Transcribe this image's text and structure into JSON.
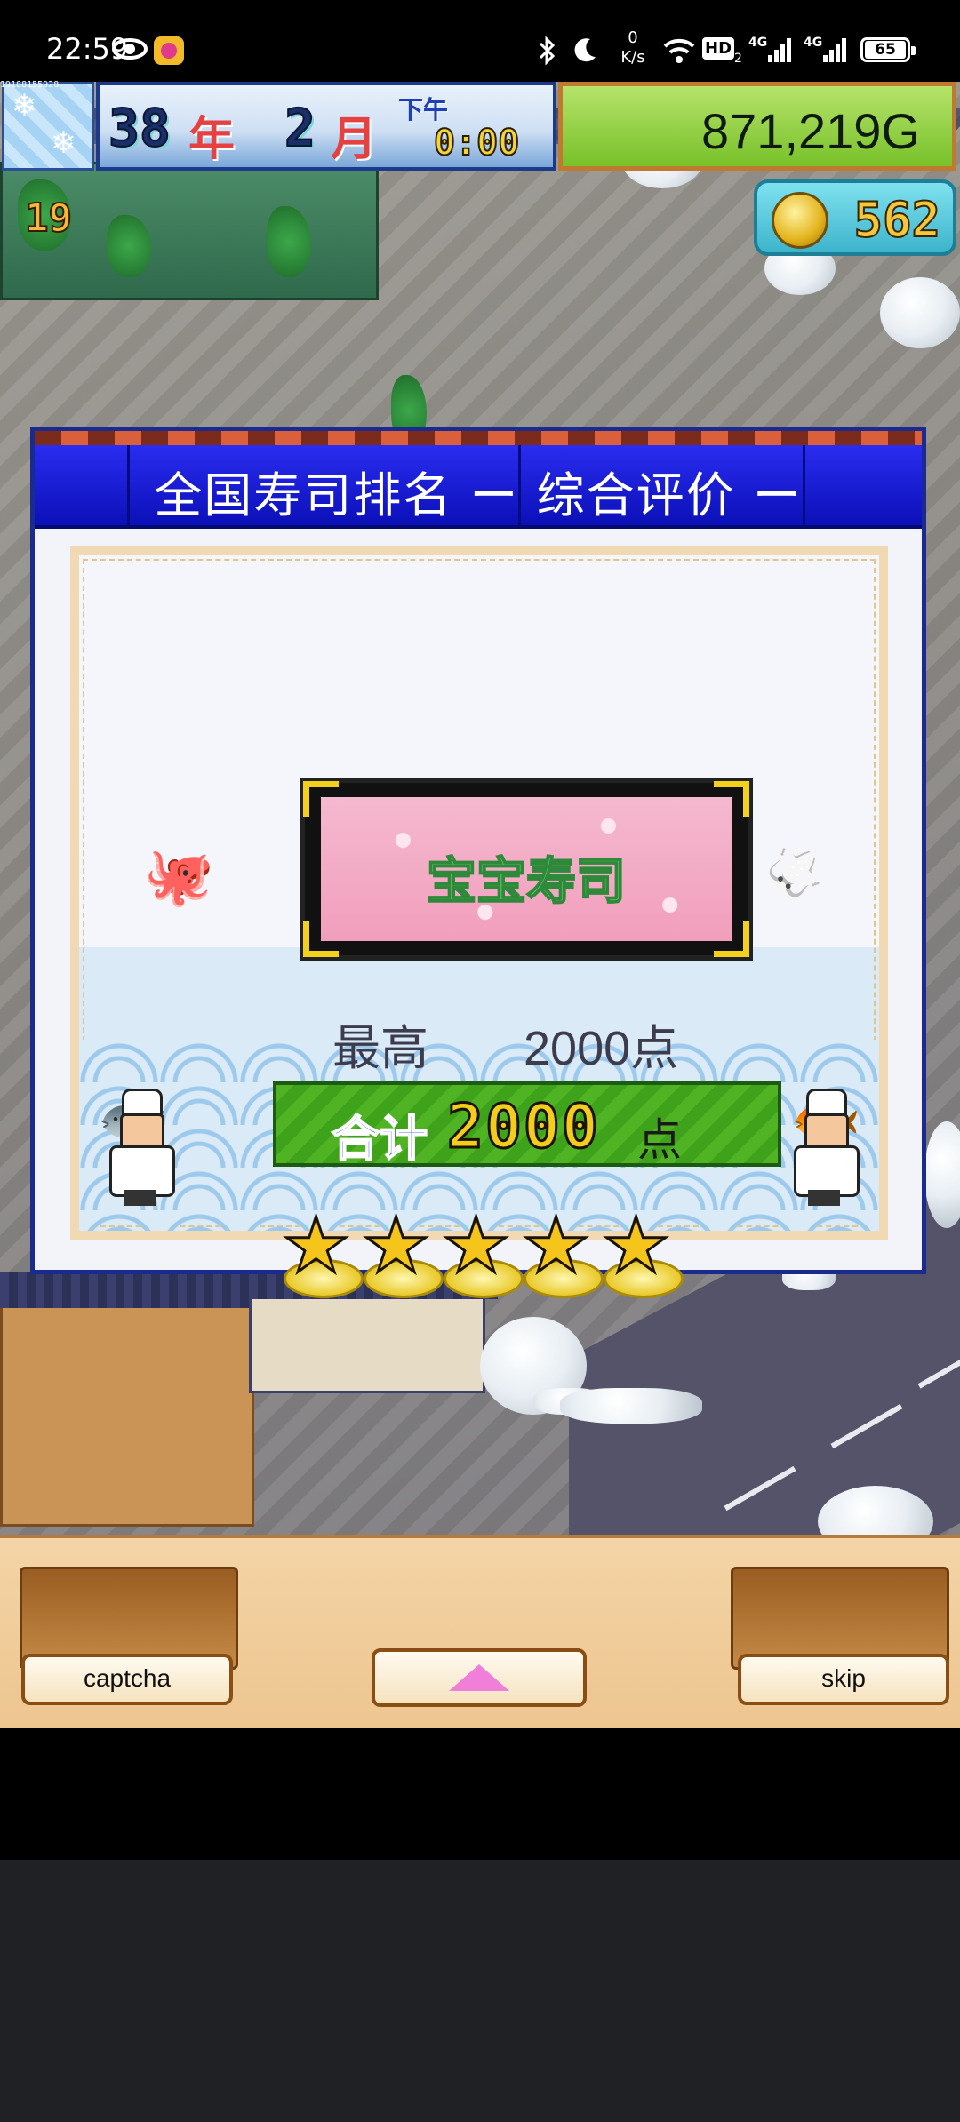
{
  "status_bar": {
    "time": "22:59",
    "net_speed_value": "0",
    "net_speed_unit": "K/s",
    "hd_label": "HD",
    "sim_index": "2",
    "signal1_label": "4G",
    "signal2_label": "4G",
    "battery": "65"
  },
  "hud": {
    "device_tag": "19188155928",
    "year_number": "38",
    "year_unit": "年",
    "month_number": "2",
    "month_unit": "月",
    "period": "下午",
    "clock": "0:00",
    "money": "871,219G",
    "level": "19",
    "coins": "562"
  },
  "dialog": {
    "title": "全国寿司排名 ー 综合评价 ー",
    "shop_name": "宝宝寿司",
    "best_label": "最高",
    "best_value": "2000点",
    "total_label": "合计",
    "total_value": "2000",
    "total_unit": "点",
    "stars": 5
  },
  "controls": {
    "left_button": "captcha",
    "right_button": "skip"
  },
  "colors": {
    "dialog_header": "#1c24d6",
    "money_bar": "#8fd03a",
    "total_bar": "#45a81e",
    "star": "#f6c51c",
    "shop_plate": "#f4acc6"
  }
}
